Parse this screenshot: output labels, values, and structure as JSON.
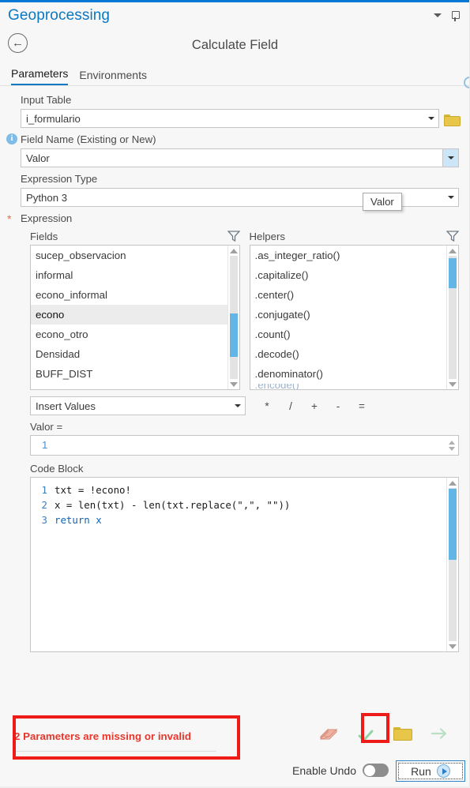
{
  "window": {
    "title": "Geoprocessing",
    "collapse_icon": "chevron-down-icon",
    "pin_icon": "pin-icon",
    "accent_color": "#0078d4"
  },
  "tool": {
    "back_icon": "back-arrow-icon",
    "title": "Calculate Field"
  },
  "tabs": [
    {
      "label": "Parameters",
      "active": true
    },
    {
      "label": "Environments",
      "active": false
    }
  ],
  "form": {
    "input_table": {
      "label": "Input Table",
      "value": "i_formulario",
      "browse_icon": "folder-icon"
    },
    "field_name": {
      "label": "Field Name (Existing or New)",
      "value": "Valor",
      "info_icon": "info-icon"
    },
    "expression_type": {
      "label": "Expression Type",
      "value": "Python 3"
    },
    "expression": {
      "label": "Expression",
      "required_marker": "*"
    }
  },
  "tooltip": {
    "text": "Valor"
  },
  "fields_panel": {
    "caption": "Fields",
    "filter_icon": "funnel-icon",
    "items": [
      {
        "label": "sucep_observacion",
        "selected": false
      },
      {
        "label": "informal",
        "selected": false
      },
      {
        "label": "econo_informal",
        "selected": false
      },
      {
        "label": "econo",
        "selected": true
      },
      {
        "label": "econo_otro",
        "selected": false
      },
      {
        "label": "Densidad",
        "selected": false
      },
      {
        "label": "BUFF_DIST",
        "selected": false
      }
    ]
  },
  "helpers_panel": {
    "caption": "Helpers",
    "filter_icon": "funnel-icon",
    "items": [
      {
        "label": ".as_integer_ratio()"
      },
      {
        "label": ".capitalize()"
      },
      {
        "label": ".center()"
      },
      {
        "label": ".conjugate()"
      },
      {
        "label": ".count()"
      },
      {
        "label": ".decode()"
      },
      {
        "label": ".denominator()"
      }
    ]
  },
  "insert_values": {
    "label": "Insert Values",
    "operators": [
      "*",
      "/",
      "+",
      "-",
      "="
    ]
  },
  "expression_value": {
    "label": "Valor =",
    "value": "1"
  },
  "code_block": {
    "label": "Code Block",
    "lines": [
      {
        "no": "1",
        "text": "txt = !econo!"
      },
      {
        "no": "2",
        "text": "x = len(txt) - len(txt.replace(\",\", \"\"))"
      },
      {
        "no": "3",
        "text": "return x"
      }
    ]
  },
  "status": {
    "message": "2 Parameters are missing or invalid",
    "message_color": "#e8362b",
    "highlight_color": "#ee1c18"
  },
  "action_icons": [
    {
      "name": "book-icon",
      "title": "Tool Help"
    },
    {
      "name": "check-icon",
      "title": "Validate"
    },
    {
      "name": "folder-icon",
      "title": "Open"
    },
    {
      "name": "arrow-right-icon",
      "title": "Next"
    }
  ],
  "enable_undo": {
    "label": "Enable Undo",
    "state": "off"
  },
  "run_button": {
    "label": "Run",
    "icon": "play-icon"
  },
  "help": {
    "icon": "help-circle-icon"
  }
}
